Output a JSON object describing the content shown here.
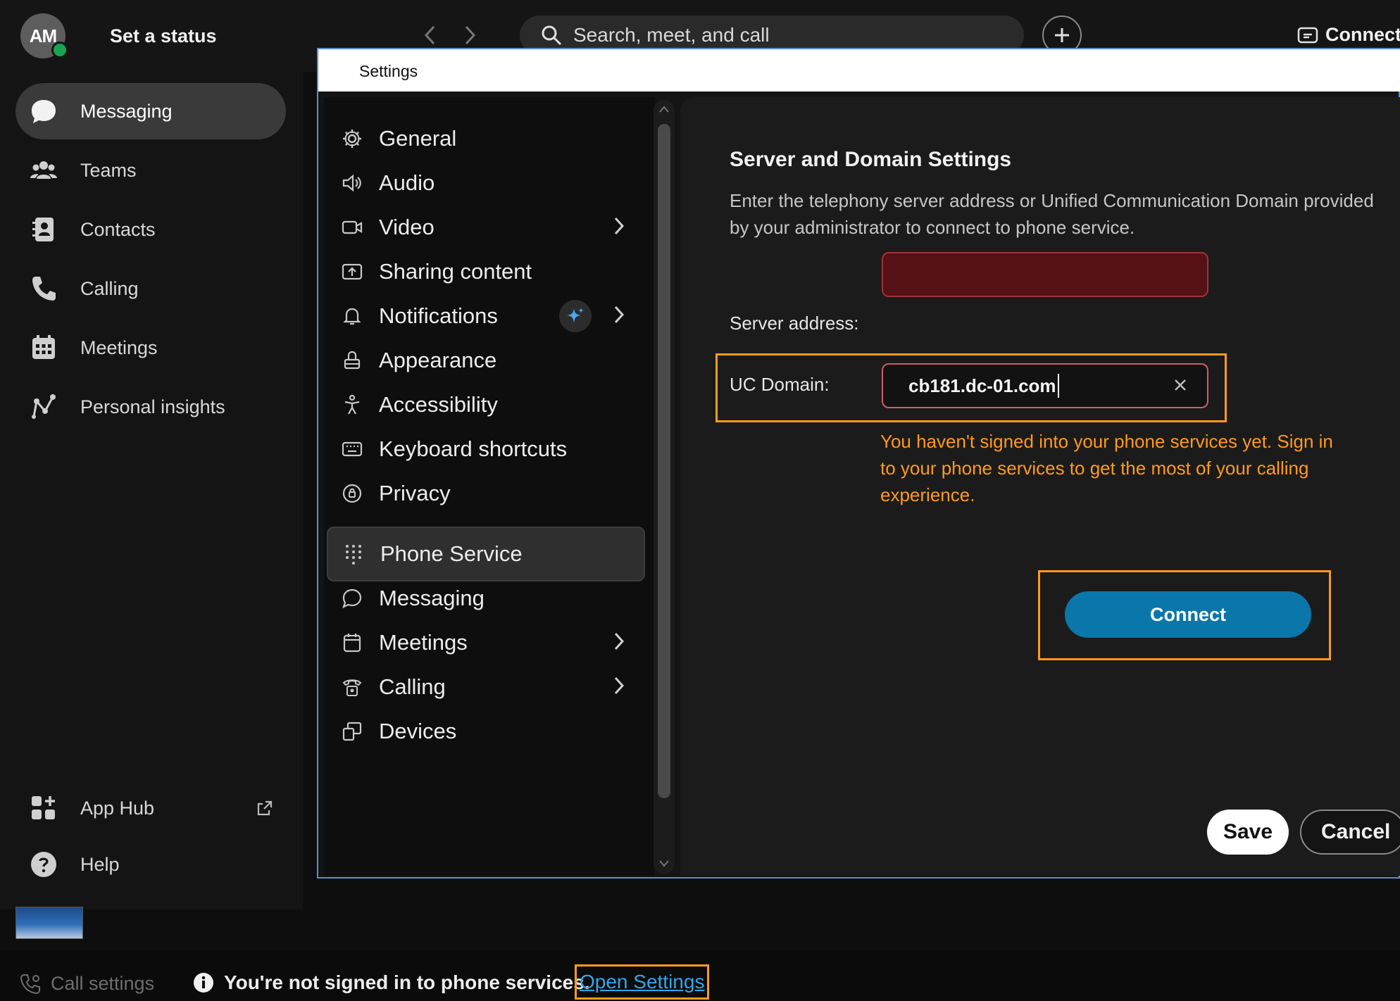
{
  "header": {
    "avatar_initials": "AM",
    "status_label": "Set a status",
    "search_placeholder": "Search, meet, and call",
    "connect_label": "Connect"
  },
  "sidebar": {
    "items": [
      {
        "label": "Messaging",
        "icon": "chat-bubble-icon",
        "active": true
      },
      {
        "label": "Teams",
        "icon": "people-icon"
      },
      {
        "label": "Contacts",
        "icon": "contact-book-icon"
      },
      {
        "label": "Calling",
        "icon": "phone-icon"
      },
      {
        "label": "Meetings",
        "icon": "calendar-icon"
      },
      {
        "label": "Personal insights",
        "icon": "insights-icon"
      }
    ],
    "app_hub_label": "App Hub",
    "help_label": "Help"
  },
  "bottom_bar": {
    "call_settings_label": "Call settings",
    "notice_text": "You're not signed in to phone services.",
    "open_settings_label": "Open Settings"
  },
  "dialog": {
    "title": "Settings",
    "menu": [
      {
        "label": "General",
        "icon": "gear-icon"
      },
      {
        "label": "Audio",
        "icon": "speaker-icon"
      },
      {
        "label": "Video",
        "icon": "video-camera-icon",
        "chevron": true
      },
      {
        "label": "Sharing content",
        "icon": "share-screen-icon"
      },
      {
        "label": "Notifications",
        "icon": "bell-icon",
        "chevron": true,
        "badge": "sparkle-icon"
      },
      {
        "label": "Appearance",
        "icon": "paint-bucket-icon"
      },
      {
        "label": "Accessibility",
        "icon": "accessibility-icon"
      },
      {
        "label": "Keyboard shortcuts",
        "icon": "keyboard-icon"
      },
      {
        "label": "Privacy",
        "icon": "privacy-icon"
      },
      {
        "label": "Phone Service",
        "icon": "dialpad-icon",
        "selected": true
      },
      {
        "label": "Messaging",
        "icon": "chat-bubble-icon"
      },
      {
        "label": "Meetings",
        "icon": "calendar-icon",
        "chevron": true
      },
      {
        "label": "Calling",
        "icon": "desk-phone-icon",
        "chevron": true
      },
      {
        "label": "Devices",
        "icon": "devices-icon"
      }
    ],
    "content": {
      "heading": "Server and Domain Settings",
      "description": "Enter the telephony server address or Unified Communication Domain provided by your administrator to connect to phone service.",
      "server_label": "Server address:",
      "server_value": "",
      "uc_label": "UC Domain:",
      "uc_value": "cb181.dc-01.com",
      "warning": "You haven't signed into your phone services yet. Sign in to your phone services to get the most of your calling experience.",
      "connect_label": "Connect",
      "save_label": "Save",
      "cancel_label": "Cancel"
    }
  },
  "colors": {
    "accent_orange": "#ff9a1f",
    "connect_blue": "#0a76a9",
    "link_blue": "#2fa6ea",
    "error_red": "#551116",
    "presence_green": "#1aa351"
  }
}
